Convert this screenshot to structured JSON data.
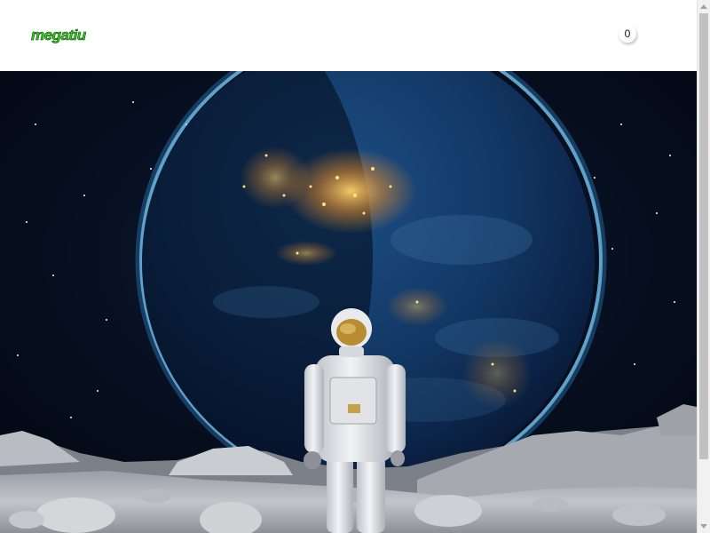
{
  "header": {
    "logo_text": "megatiu",
    "logo_color": "#2fd11a",
    "cart_count": "0"
  },
  "hero": {
    "image_subject": "astronaut-on-moon-facing-earth"
  },
  "scrollbar": {
    "thumb_color": "#c1c1c1",
    "track_color": "#f1f1f1"
  }
}
